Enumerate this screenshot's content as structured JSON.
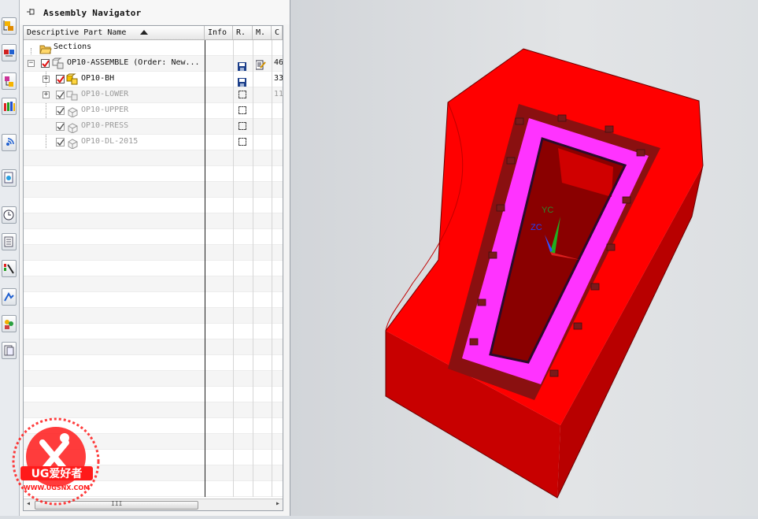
{
  "navigator": {
    "title": "Assembly Navigator",
    "columns": {
      "name": "Descriptive Part Name",
      "info": "Info",
      "r": "R.",
      "m": "M.",
      "c": "C"
    },
    "rows": [
      {
        "label": "Sections",
        "count": ""
      },
      {
        "label": "OP10-ASSEMBLE  (Order: New...",
        "count": "46"
      },
      {
        "label": "OP10-BH",
        "count": "33"
      },
      {
        "label": "OP10-LOWER",
        "count": "11"
      },
      {
        "label": "OP10-UPPER",
        "count": ""
      },
      {
        "label": "OP10-PRESS",
        "count": ""
      },
      {
        "label": "OP10-DL-2015",
        "count": ""
      }
    ],
    "scroll": {
      "thumb_glyph": "III",
      "left_arrow": "◂",
      "right_arrow": "▸"
    }
  },
  "resource_bar": {
    "icons": [
      "assembly-navigator-icon",
      "constraint-navigator-icon",
      "part-navigator-icon",
      "reuse-library-icon",
      "hd3d-tools-icon",
      "web-browser-icon",
      "history-icon",
      "system-materials-icon",
      "process-studio-icon",
      "manufacturing-wizard-icon",
      "roles-icon",
      "system-scenes-icon"
    ]
  },
  "viewport": {
    "triad": {
      "y_label": "YC",
      "z_label": "ZC"
    },
    "colors": {
      "block": "#ff0000",
      "block_side": "#c80000",
      "insert": "#ff33ff",
      "background": "#dcdfe2"
    }
  },
  "watermark": {
    "brand": "UG爱好者",
    "url": "WWW.UGSNX.COM"
  }
}
